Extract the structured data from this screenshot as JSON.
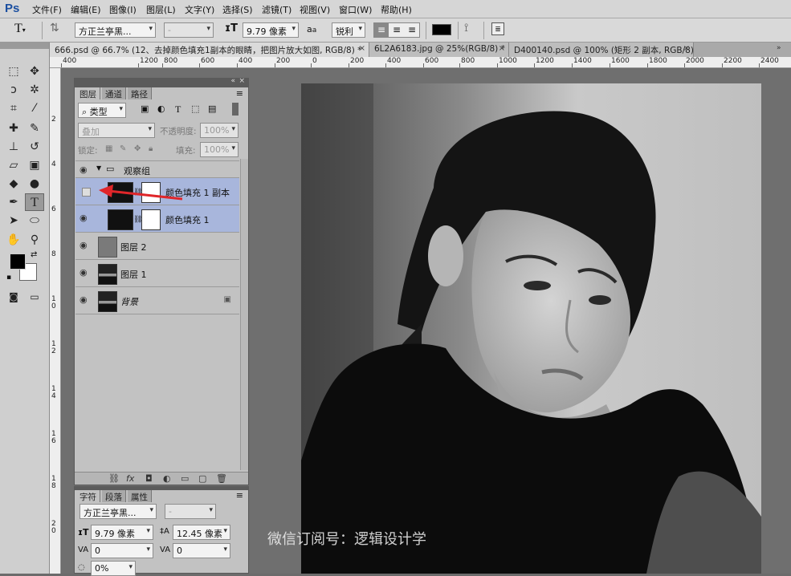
{
  "app": {
    "logo": "Ps"
  },
  "menu": [
    "文件(F)",
    "编辑(E)",
    "图像(I)",
    "图层(L)",
    "文字(Y)",
    "选择(S)",
    "滤镜(T)",
    "视图(V)",
    "窗口(W)",
    "帮助(H)"
  ],
  "options": {
    "font_family": "方正兰亭黑...",
    "font_style": "-",
    "font_size": "9.79 像素",
    "aa_label": "a",
    "antialias": "锐利",
    "color": "#000000"
  },
  "tabs": [
    {
      "label": "666.psd @ 66.7% (12、去掉颜色填充1副本的眼睛，把图片放大如图, RGB/8) *",
      "close": "×"
    },
    {
      "label": "6L2A6183.jpg @ 25%(RGB/8) *",
      "close": "×"
    },
    {
      "label": "D400140.psd @ 100% (矩形 2 副本, RGB/8) *",
      "close": "×"
    }
  ],
  "ruler_top": [
    "400",
    "1200",
    "800",
    "600",
    "400",
    "200",
    "0",
    "200",
    "400",
    "600",
    "800",
    "1000",
    "1200",
    "1400",
    "1600",
    "1800",
    "2000",
    "2200",
    "2400",
    "2600"
  ],
  "ruler_left": [
    "2",
    "4",
    "6",
    "8",
    "1 0",
    "1 2",
    "1 4",
    "1 6",
    "1 8",
    "2 0"
  ],
  "layers_panel": {
    "tabs": [
      "图层",
      "通道",
      "路径"
    ],
    "filter_kind": "类型",
    "blend_mode": "叠加",
    "opacity_label": "不透明度:",
    "opacity_value": "100%",
    "lock_label": "锁定:",
    "fill_label": "填充:",
    "fill_value": "100%",
    "group_name": "观察组",
    "layers": [
      {
        "name": "颜色填充 1 副本",
        "visible": false,
        "selected": true,
        "type": "fill"
      },
      {
        "name": "颜色填充 1",
        "visible": true,
        "selected": true,
        "type": "fill"
      },
      {
        "name": "图层 2",
        "visible": true,
        "selected": false,
        "type": "gray"
      },
      {
        "name": "图层 1",
        "visible": true,
        "selected": false,
        "type": "photo"
      },
      {
        "name": "背景",
        "visible": true,
        "selected": false,
        "type": "photo",
        "locked": true
      }
    ],
    "footer_fx": "fx"
  },
  "char_panel": {
    "tabs": [
      "字符",
      "段落",
      "属性"
    ],
    "font_family": "方正兰亭黑...",
    "font_style": "-",
    "font_size": "9.79 像素",
    "leading": "12.45 像素",
    "kerning": "0",
    "tracking": "0",
    "scale": "0%"
  },
  "watermark": "微信订阅号：逻辑设计学"
}
